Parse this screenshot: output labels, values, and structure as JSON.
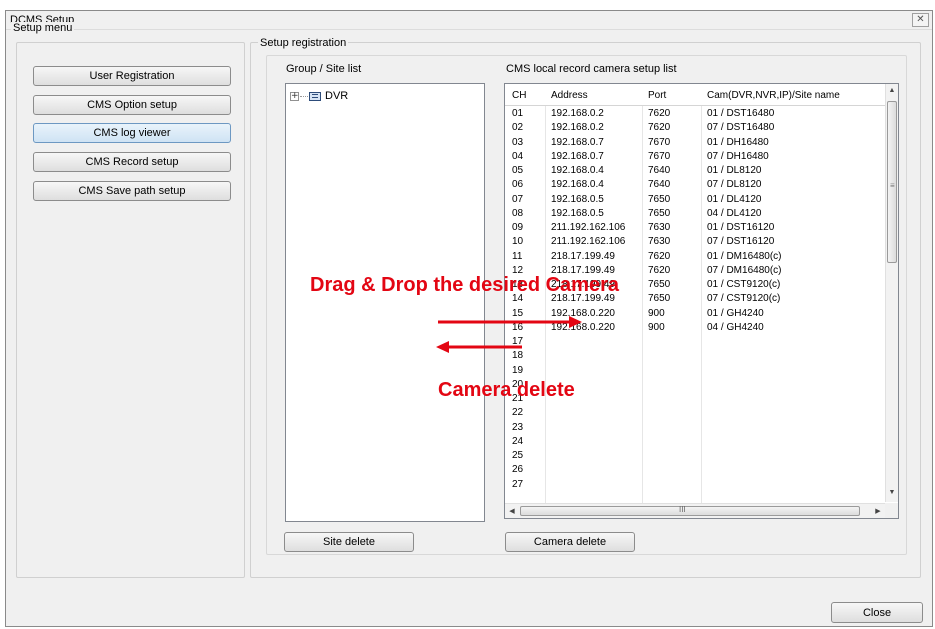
{
  "window": {
    "title": "DCMS Setup",
    "close_glyph": "✕"
  },
  "setup_menu": {
    "label": "Setup menu",
    "buttons": [
      {
        "label": "User Registration"
      },
      {
        "label": "CMS Option setup"
      },
      {
        "label": "CMS log viewer"
      },
      {
        "label": "CMS Record setup"
      },
      {
        "label": "CMS Save path setup"
      }
    ],
    "selected_index": 2
  },
  "registration": {
    "label": "Setup registration",
    "group_site_list": {
      "label": "Group / Site list",
      "tree": [
        {
          "expander": "+",
          "icon": "dvr-icon",
          "label": "DVR"
        }
      ],
      "delete_label": "Site delete"
    },
    "camera_list": {
      "label": "CMS local record camera setup list",
      "columns": [
        "CH",
        "Address",
        "Port",
        "Cam(DVR,NVR,IP)/Site name"
      ],
      "rows": [
        [
          "01",
          "192.168.0.2",
          "7620",
          "01 / DST16480"
        ],
        [
          "02",
          "192.168.0.2",
          "7620",
          "07 / DST16480"
        ],
        [
          "03",
          "192.168.0.7",
          "7670",
          "01 / DH16480"
        ],
        [
          "04",
          "192.168.0.7",
          "7670",
          "07 / DH16480"
        ],
        [
          "05",
          "192.168.0.4",
          "7640",
          "01 / DL8120"
        ],
        [
          "06",
          "192.168.0.4",
          "7640",
          "07 / DL8120"
        ],
        [
          "07",
          "192.168.0.5",
          "7650",
          "01 / DL4120"
        ],
        [
          "08",
          "192.168.0.5",
          "7650",
          "04 / DL4120"
        ],
        [
          "09",
          "211.192.162.106",
          "7630",
          "01 / DST16120"
        ],
        [
          "10",
          "211.192.162.106",
          "7630",
          "07 / DST16120"
        ],
        [
          "11",
          "218.17.199.49",
          "7620",
          "01 / DM16480(c)"
        ],
        [
          "12",
          "218.17.199.49",
          "7620",
          "07 / DM16480(c)"
        ],
        [
          "13",
          "218.17.199.49",
          "7650",
          "01 / CST9120(c)"
        ],
        [
          "14",
          "218.17.199.49",
          "7650",
          "07 / CST9120(c)"
        ],
        [
          "15",
          "192.168.0.220",
          "900",
          "01 / GH4240"
        ],
        [
          "16",
          "192.168.0.220",
          "900",
          "04 / GH4240"
        ],
        [
          "17",
          "",
          "",
          ""
        ],
        [
          "18",
          "",
          "",
          ""
        ],
        [
          "19",
          "",
          "",
          ""
        ],
        [
          "20",
          "",
          "",
          ""
        ],
        [
          "21",
          "",
          "",
          ""
        ],
        [
          "22",
          "",
          "",
          ""
        ],
        [
          "23",
          "",
          "",
          ""
        ],
        [
          "24",
          "",
          "",
          ""
        ],
        [
          "25",
          "",
          "",
          ""
        ],
        [
          "26",
          "",
          "",
          ""
        ],
        [
          "27",
          "",
          "",
          ""
        ]
      ],
      "delete_label": "Camera delete",
      "scroll_glyphs": {
        "up": "▲",
        "down": "▼",
        "left": "◀",
        "right": "▶",
        "v_grip": "≡",
        "h_grip": "III"
      }
    }
  },
  "annotations": {
    "drag_drop": "Drag & Drop the desired Camera",
    "camera_delete": "Camera delete",
    "color": "#e30613"
  },
  "footer": {
    "close_label": "Close"
  }
}
